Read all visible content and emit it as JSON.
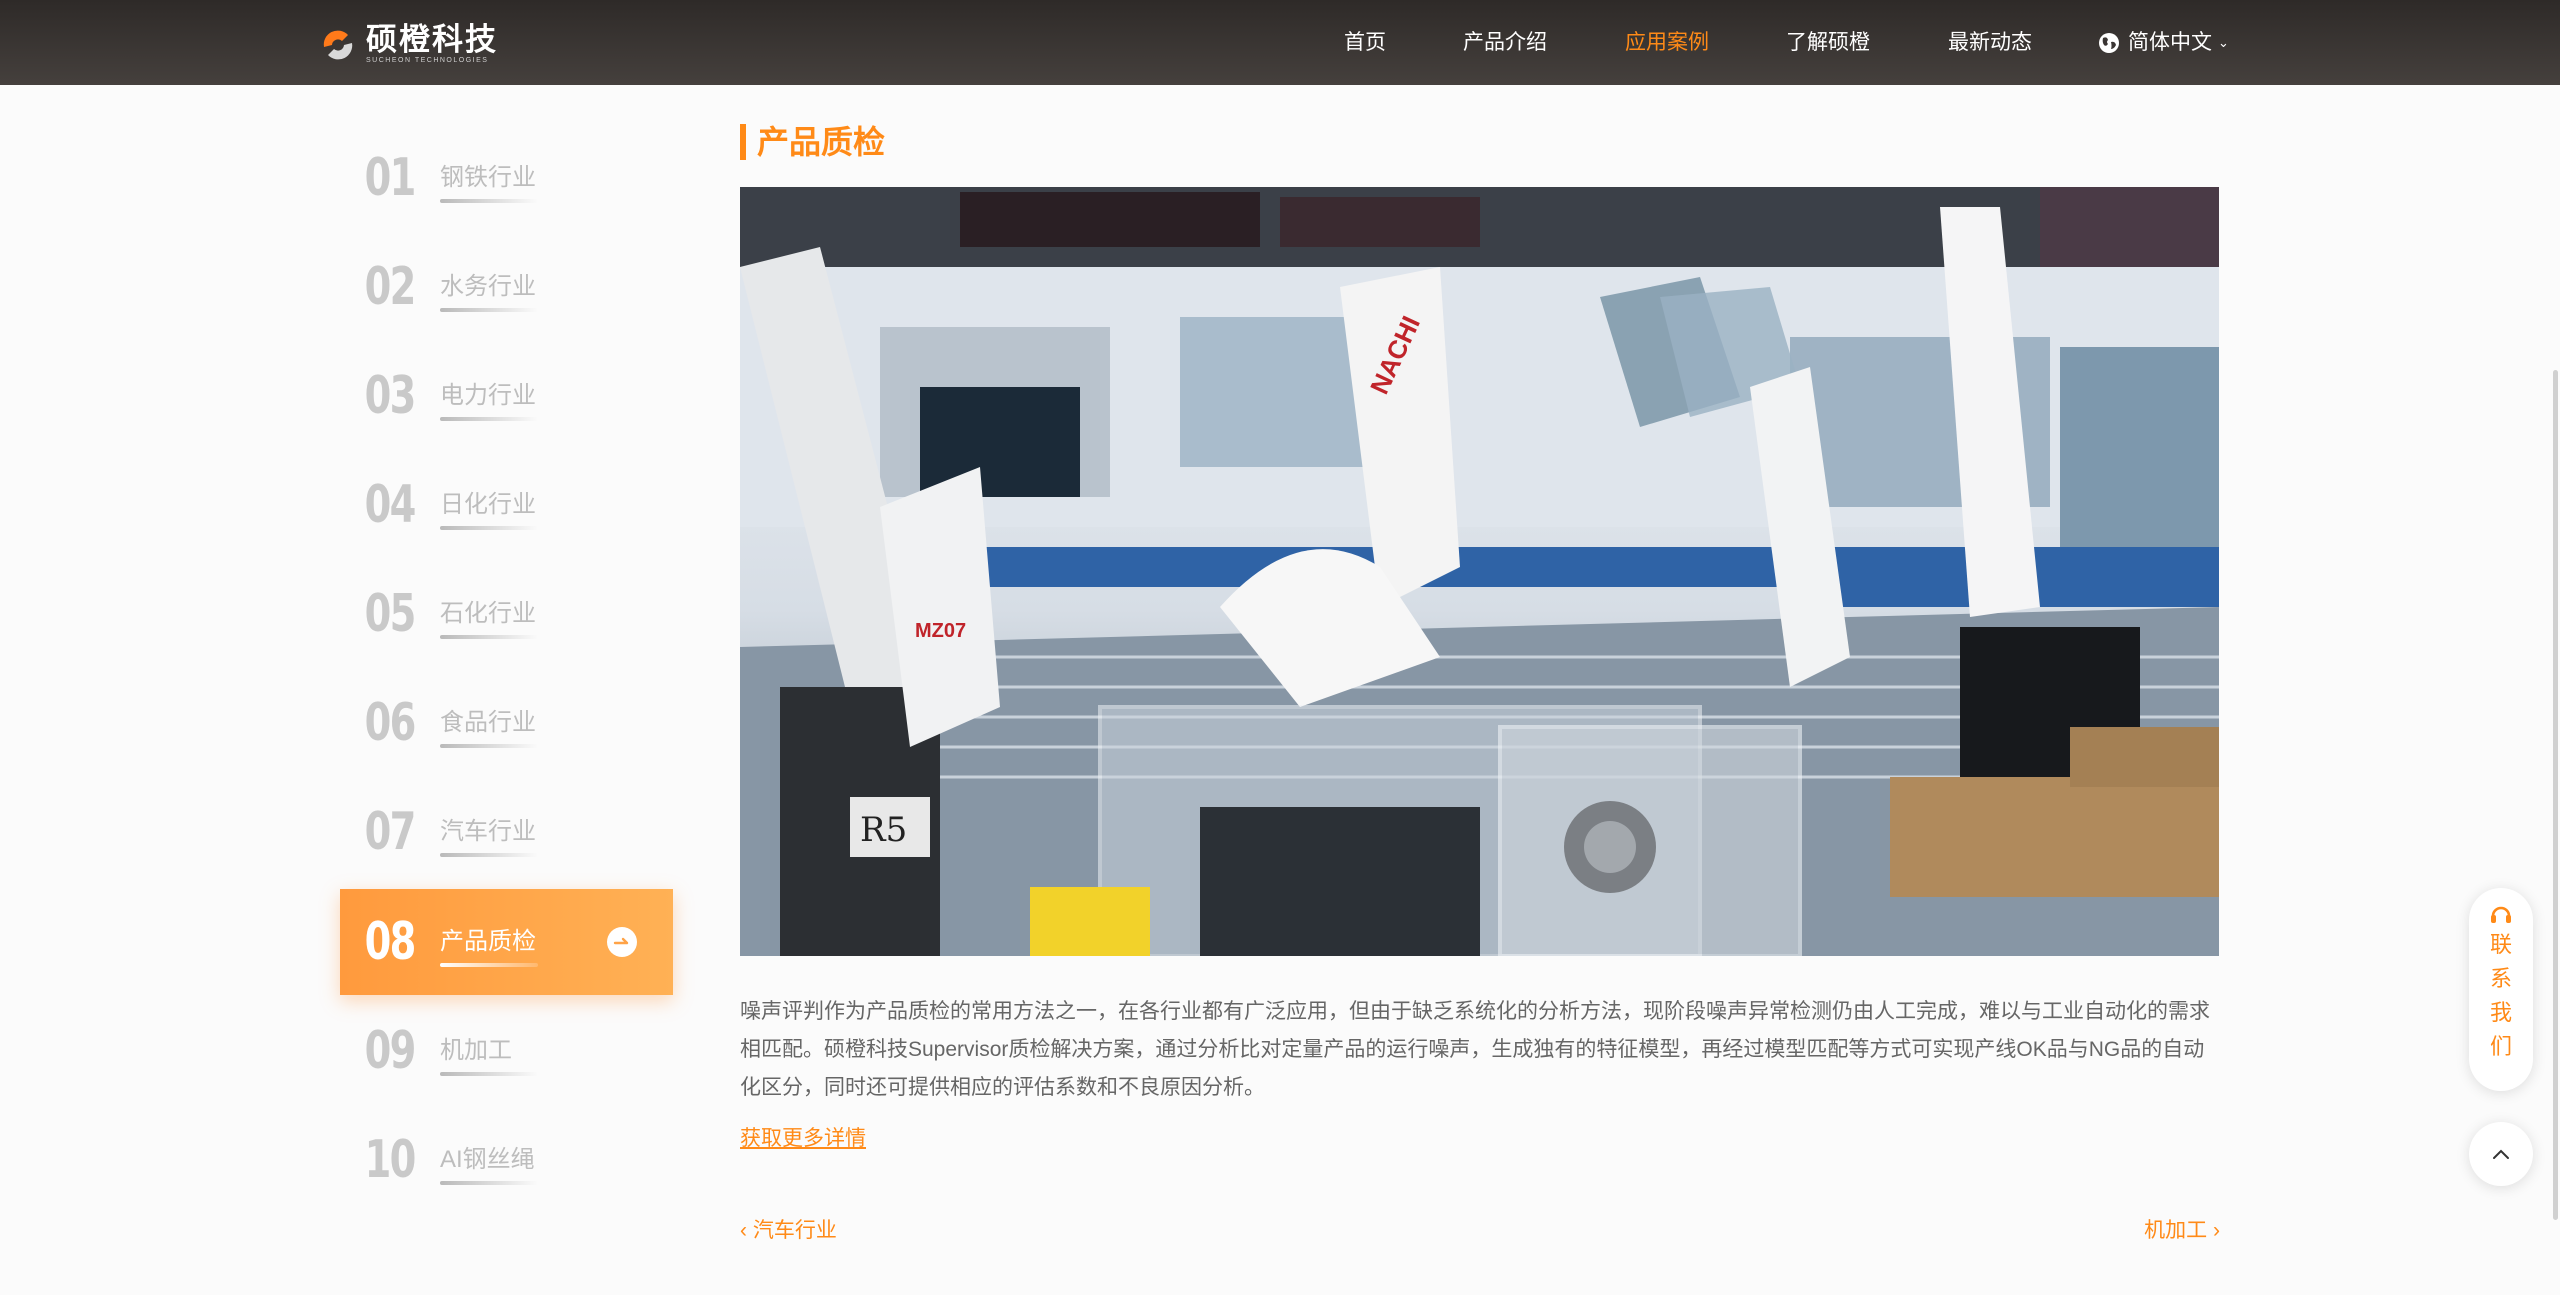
{
  "header": {
    "logo": {
      "name_cn": "硕橙科技",
      "name_en": "SUCHEON TECHNOLOGIES"
    },
    "nav": [
      {
        "label": "首页",
        "active": false
      },
      {
        "label": "产品介绍",
        "active": false
      },
      {
        "label": "应用案例",
        "active": true
      },
      {
        "label": "了解硕橙",
        "active": false
      },
      {
        "label": "最新动态",
        "active": false
      }
    ],
    "language": {
      "label": "简体中文",
      "icon": "globe-icon"
    }
  },
  "sidebar": {
    "items": [
      {
        "num": "01",
        "label": "钢铁行业"
      },
      {
        "num": "02",
        "label": "水务行业"
      },
      {
        "num": "03",
        "label": "电力行业"
      },
      {
        "num": "04",
        "label": "日化行业"
      },
      {
        "num": "05",
        "label": "石化行业"
      },
      {
        "num": "06",
        "label": "食品行业"
      },
      {
        "num": "07",
        "label": "汽车行业"
      },
      {
        "num": "08",
        "label": "产品质检",
        "active": true
      },
      {
        "num": "09",
        "label": "机加工"
      },
      {
        "num": "10",
        "label": "AI钢丝绳"
      }
    ]
  },
  "main": {
    "title": "产品质检",
    "description": "噪声评判作为产品质检的常用方法之一，在各行业都有广泛应用，但由于缺乏系统化的分析方法，现阶段噪声异常检测仍由人工完成，难以与工业自动化的需求相匹配。硕橙科技Supervisor质检解决方案，通过分析比对定量产品的运行噪声，生成独有的特征模型，再经过模型匹配等方式可实现产线OK品与NG品的自动化区分，同时还可提供相应的评估系数和不良原因分析。",
    "more_link": "获取更多详情",
    "prev": "汽车行业",
    "next": "机加工",
    "hero_labels": {
      "robot_a": "MZ07",
      "robot_b": "NACHI",
      "box": "R5"
    }
  },
  "floating": {
    "contact": "联系我们",
    "top_icon": "chevron-up-icon"
  },
  "colors": {
    "accent": "#ff8a17",
    "header_bg": "#3a3533",
    "sidebar_active": "#ffa347"
  }
}
